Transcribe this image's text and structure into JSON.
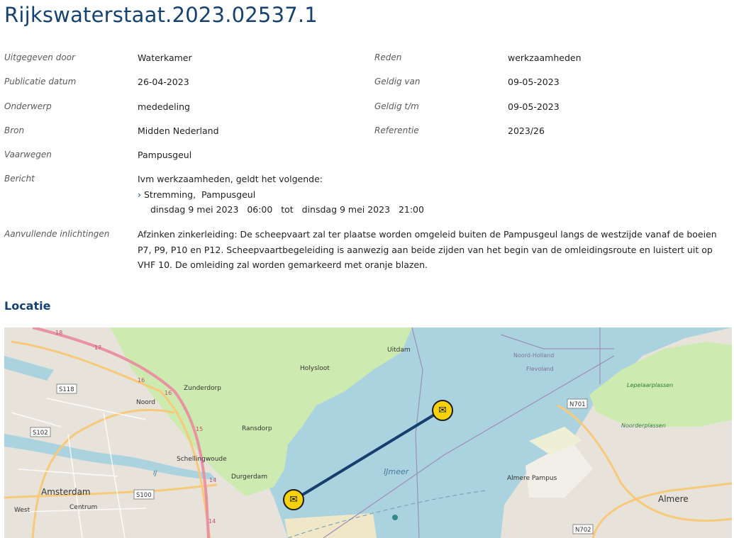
{
  "title": "Rijkswaterstaat.2023.02537.1",
  "fields_left": [
    {
      "label": "Uitgegeven door",
      "value": "Waterkamer"
    },
    {
      "label": "Publicatie datum",
      "value": "26-04-2023"
    },
    {
      "label": "Onderwerp",
      "value": "mededeling"
    },
    {
      "label": "Bron",
      "value": "Midden Nederland"
    },
    {
      "label": "Vaarwegen",
      "value": "Pampusgeul"
    }
  ],
  "fields_right": [
    {
      "label": "Reden",
      "value": "werkzaamheden"
    },
    {
      "label": "Geldig van",
      "value": "09-05-2023"
    },
    {
      "label": "Geldig t/m",
      "value": "09-05-2023"
    },
    {
      "label": "Referentie",
      "value": "2023/26"
    }
  ],
  "bericht": {
    "label": "Bericht",
    "intro": "Ivm werkzaamheden, geldt het volgende:",
    "item": "Stremming,  Pampusgeul",
    "period": "dinsdag 9 mei 2023   06:00   tot   dinsdag 9 mei 2023   21:00"
  },
  "aanvullend": {
    "label": "Aanvullende inlichtingen",
    "text": "Afzinken zinkerleiding: De scheepvaart zal ter plaatse worden omgeleid buiten de Pampusgeul langs de westzijde vanaf de boeien P7, P9, P10 en P12. Scheepvaartbegeleiding is aanwezig aan beide zijden van het begin van de omleidingsroute en luistert uit op VHF 10. De omleiding zal worden gemarkeerd met oranje blazen."
  },
  "locatie_heading": "Locatie",
  "map": {
    "colors": {
      "water": "#aad3df",
      "land": "#f2efe9",
      "green": "#cdebb0",
      "route": "#173f6e",
      "pin": "#f5d20a"
    },
    "labels": {
      "amsterdam": "Amsterdam",
      "noord": "Noord",
      "west": "West",
      "centrum": "Centrum",
      "zunderdorp": "Zunderdorp",
      "holysloot": "Holysloot",
      "uitdam": "Uitdam",
      "ransdorp": "Ransdorp",
      "schellingwoude": "Schellingwoude",
      "durgerdam": "Durgerdam",
      "ijmeer": "IJmeer",
      "noord_holland": "Noord-Holland",
      "flevoland": "Flevoland",
      "almere_pampus": "Almere Pampus",
      "almere": "Almere",
      "lepelaarplassen": "Lepelaarplassen",
      "noorderplassen": "Noorderplassen",
      "ij": "IJ",
      "s118": "S118",
      "s102": "S102",
      "s100": "S100",
      "n701": "N701",
      "n702": "N702",
      "r18": "18",
      "r17": "17",
      "r16a": "16",
      "r16b": "16",
      "r15": "15",
      "r14": "14",
      "r14b": "14"
    },
    "icons": {
      "pin_start": "envelope-icon",
      "pin_end": "envelope-icon"
    }
  }
}
